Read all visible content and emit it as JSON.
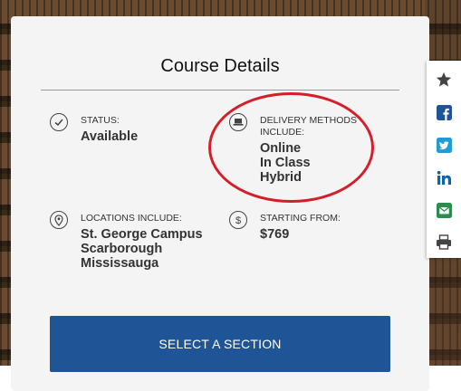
{
  "card": {
    "title": "Course Details"
  },
  "details": {
    "status": {
      "label": "STATUS:",
      "value": "Available"
    },
    "delivery": {
      "label_line1": "DELIVERY METHODS",
      "label_line2": "INCLUDE:",
      "values": [
        "Online",
        "In Class",
        "Hybrid"
      ]
    },
    "locations": {
      "label": "LOCATIONS INCLUDE:",
      "values": [
        "St. George Campus",
        "Scarborough",
        "Mississauga"
      ]
    },
    "price": {
      "label": "STARTING FROM:",
      "value": "$769"
    }
  },
  "action": {
    "select_label": "SELECT A SECTION"
  },
  "share": {
    "icons": [
      "star-icon",
      "facebook-icon",
      "twitter-icon",
      "linkedin-icon",
      "email-icon",
      "print-icon"
    ]
  },
  "colors": {
    "primary_button": "#1f5496",
    "annotation_red": "#d41f2a",
    "facebook": "#1f5496",
    "twitter": "#1f9bd7",
    "linkedin": "#0a66a5",
    "email": "#2f8a4f"
  }
}
